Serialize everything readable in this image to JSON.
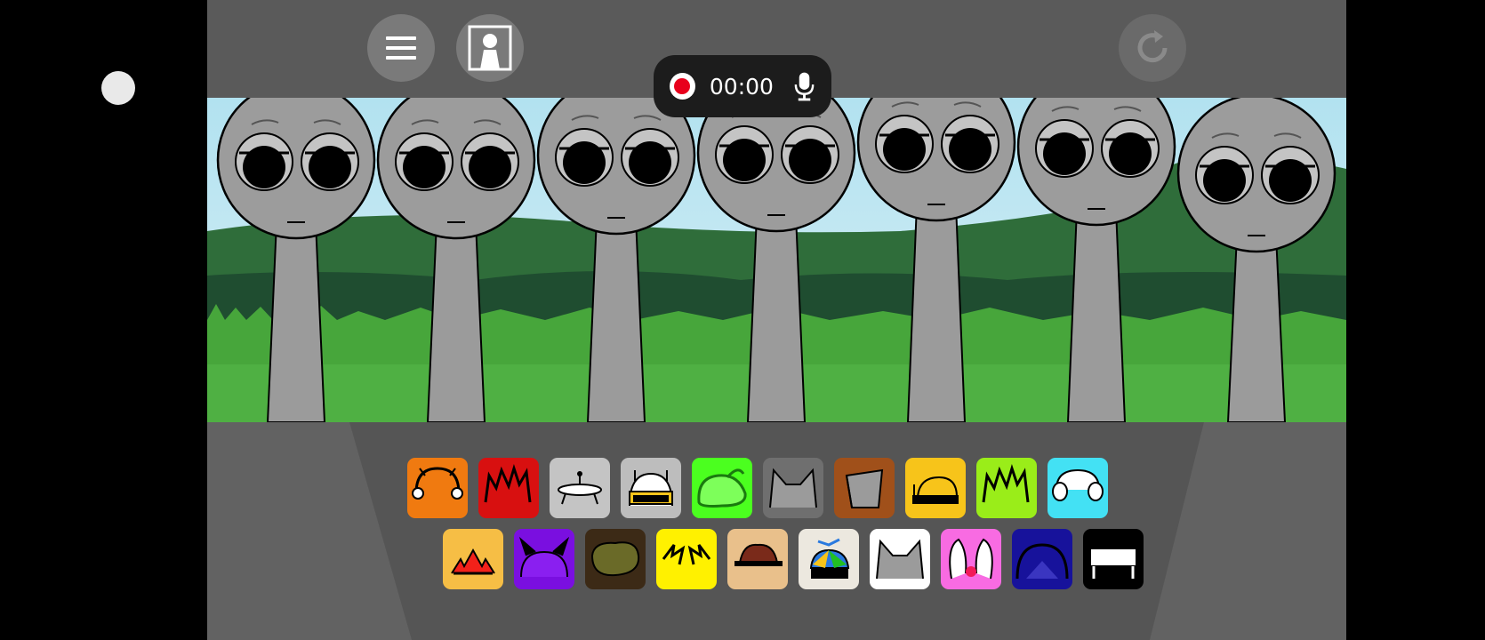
{
  "recorder": {
    "time": "00:00"
  },
  "colors": {
    "background": "#5a5a5a",
    "sky": "#aee0ef",
    "grass": "#45a53a",
    "character": "#9a9a9a",
    "record": "#e8001c"
  },
  "buttons": [
    {
      "name": "menu-button",
      "icon": "hamburger-menu-icon"
    },
    {
      "name": "character-button",
      "icon": "portrait-icon"
    },
    {
      "name": "reset-button",
      "icon": "reload-icon"
    }
  ],
  "characters": {
    "count": 7
  },
  "sound_icons": {
    "row1": [
      {
        "name": "orange-headphones",
        "color": "#f07a10",
        "icon": "headphones-icon"
      },
      {
        "name": "red-spiky",
        "color": "#d81010",
        "icon": "spiky-hair-icon"
      },
      {
        "name": "grey-ufo",
        "color": "#c4c4c4",
        "icon": "ufo-icon"
      },
      {
        "name": "grey-robot",
        "color": "#bdbdbd",
        "icon": "robot-visor-icon"
      },
      {
        "name": "green-slime",
        "color": "#4bff1f",
        "icon": "slime-icon"
      },
      {
        "name": "grey-cat-ears",
        "color": "#6f6f6f",
        "icon": "cat-ears-icon"
      },
      {
        "name": "brown-bucket",
        "color": "#a0501a",
        "icon": "bucket-icon"
      },
      {
        "name": "yellow-cap",
        "color": "#f7c41a",
        "icon": "cap-icon"
      },
      {
        "name": "lime-spiky",
        "color": "#9aed19",
        "icon": "spiky-hair-icon"
      },
      {
        "name": "cyan-earmuffs",
        "color": "#43e1f4",
        "icon": "earmuffs-icon"
      }
    ],
    "row2": [
      {
        "name": "yellow-sun",
        "color": "#f6be45",
        "icon": "sun-hat-icon"
      },
      {
        "name": "purple-horns",
        "color": "#7a0fe0",
        "icon": "horns-icon"
      },
      {
        "name": "olive-blob",
        "color": "#3c2a16",
        "icon": "blob-hair-icon"
      },
      {
        "name": "yellow-lightning",
        "color": "#fff100",
        "icon": "lightning-icon"
      },
      {
        "name": "tan-hat",
        "color": "#e9c08b",
        "icon": "fedora-icon"
      },
      {
        "name": "propeller-cap",
        "color": "#ece8df",
        "icon": "propeller-cap-icon"
      },
      {
        "name": "white-cat",
        "color": "#ffffff",
        "icon": "cat-ears-icon"
      },
      {
        "name": "pink-bunny",
        "color": "#f86be2",
        "icon": "bunny-ears-icon"
      },
      {
        "name": "navy-dome",
        "color": "#17129b",
        "icon": "dome-icon"
      },
      {
        "name": "black-bench",
        "color": "#000000",
        "icon": "bench-icon"
      }
    ]
  }
}
